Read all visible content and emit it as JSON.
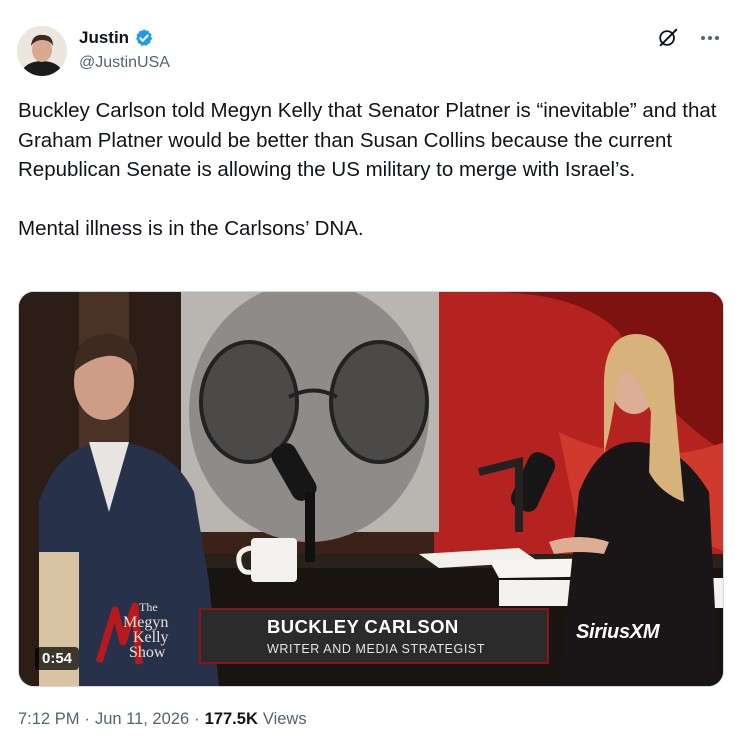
{
  "author": {
    "name": "Justin",
    "handle": "@JustinUSA"
  },
  "tweet": {
    "paragraph1": "Buckley Carlson told Megyn Kelly that Senator Platner is “inevitable” and that Graham Platner would be better than Susan Collins because the current Republican Senate is allowing the US military to merge with Israel’s.",
    "paragraph2": "Mental illness is in the Carlsons’ DNA."
  },
  "video": {
    "duration": "0:54",
    "show_logo": {
      "the": "The",
      "megyn": "Megyn",
      "kelly": "Kelly",
      "show": "Show"
    },
    "lower_third": {
      "name": "BUCKLEY CARLSON",
      "title": "WRITER AND MEDIA STRATEGIST"
    },
    "brand": "SiriusXM"
  },
  "meta": {
    "time": "7:12 PM",
    "date": "Jun 11, 2026",
    "views_count": "177.5K",
    "views_label": "Views"
  },
  "icons": {
    "verified": "verified-badge-icon",
    "grok": "grok-icon",
    "more": "more-icon"
  },
  "colors": {
    "verified_blue": "#1d9bf0",
    "muted_text": "#536471",
    "accent_red": "#8b1418"
  }
}
